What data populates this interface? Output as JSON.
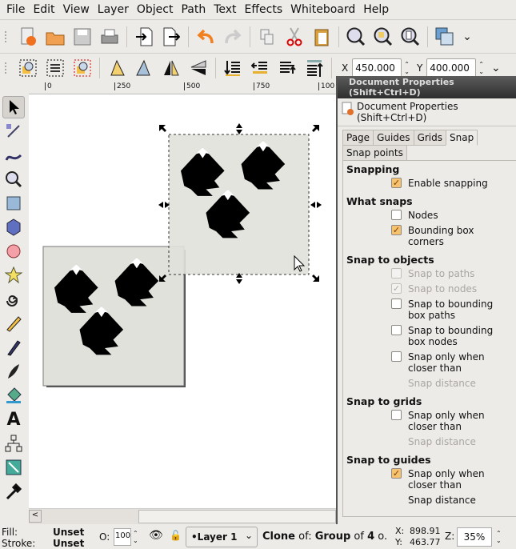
{
  "menu": [
    "File",
    "Edit",
    "View",
    "Layer",
    "Object",
    "Path",
    "Text",
    "Effects",
    "Whiteboard",
    "Help"
  ],
  "toolbar2": {
    "x_label": "X",
    "x_value": "450.000",
    "y_label": "Y",
    "y_value": "400.000"
  },
  "ruler": [
    "0",
    "250",
    "500",
    "750",
    "100"
  ],
  "dialog": {
    "titlebar": "Document Properties (Shift+Ctrl+D)",
    "header": "Document Properties (Shift+Ctrl+D)",
    "tabs": [
      "Page",
      "Guides",
      "Grids",
      "Snap",
      "Snap points"
    ],
    "active_tab": "Snap",
    "sections": {
      "snapping": "Snapping",
      "what_snaps": "What snaps",
      "snap_to_objects": "Snap to objects",
      "snap_to_grids": "Snap to grids",
      "snap_to_guides": "Snap to guides"
    },
    "options": {
      "enable_snapping": {
        "label": "Enable snapping",
        "checked": true
      },
      "nodes": {
        "label": "Nodes",
        "checked": false
      },
      "bbox_corners": {
        "label": "Bounding box corners",
        "checked": true
      },
      "snap_paths": {
        "label": "Snap to paths",
        "checked": false,
        "disabled": true
      },
      "snap_nodes": {
        "label": "Snap to nodes",
        "checked": true,
        "disabled": true
      },
      "snap_bbox_paths": {
        "label": "Snap to bounding box paths",
        "checked": false
      },
      "snap_bbox_nodes": {
        "label": "Snap to bounding box nodes",
        "checked": false
      },
      "obj_close": {
        "label": "Snap only when closer than",
        "checked": false
      },
      "obj_distance": "Snap distance",
      "grid_close": {
        "label": "Snap only when closer than",
        "checked": false
      },
      "grid_distance": "Snap distance",
      "guide_close": {
        "label": "Snap only when closer than",
        "checked": true
      },
      "guide_distance": "Snap distance"
    }
  },
  "status": {
    "fill_label": "Fill:",
    "fill_value": "Unset",
    "stroke_label": "Stroke:",
    "stroke_value": "Unset",
    "opacity_label": "O:",
    "opacity_value": "100",
    "layer": "•Layer 1",
    "message_parts": [
      "Clone",
      " of: ",
      "Group",
      " of ",
      "4",
      " o."
    ],
    "x_label": "X:",
    "x_value": "898.91",
    "y_label": "Y:",
    "y_value": "463.77",
    "zoom_label": "Z:",
    "zoom_value": "35%"
  }
}
